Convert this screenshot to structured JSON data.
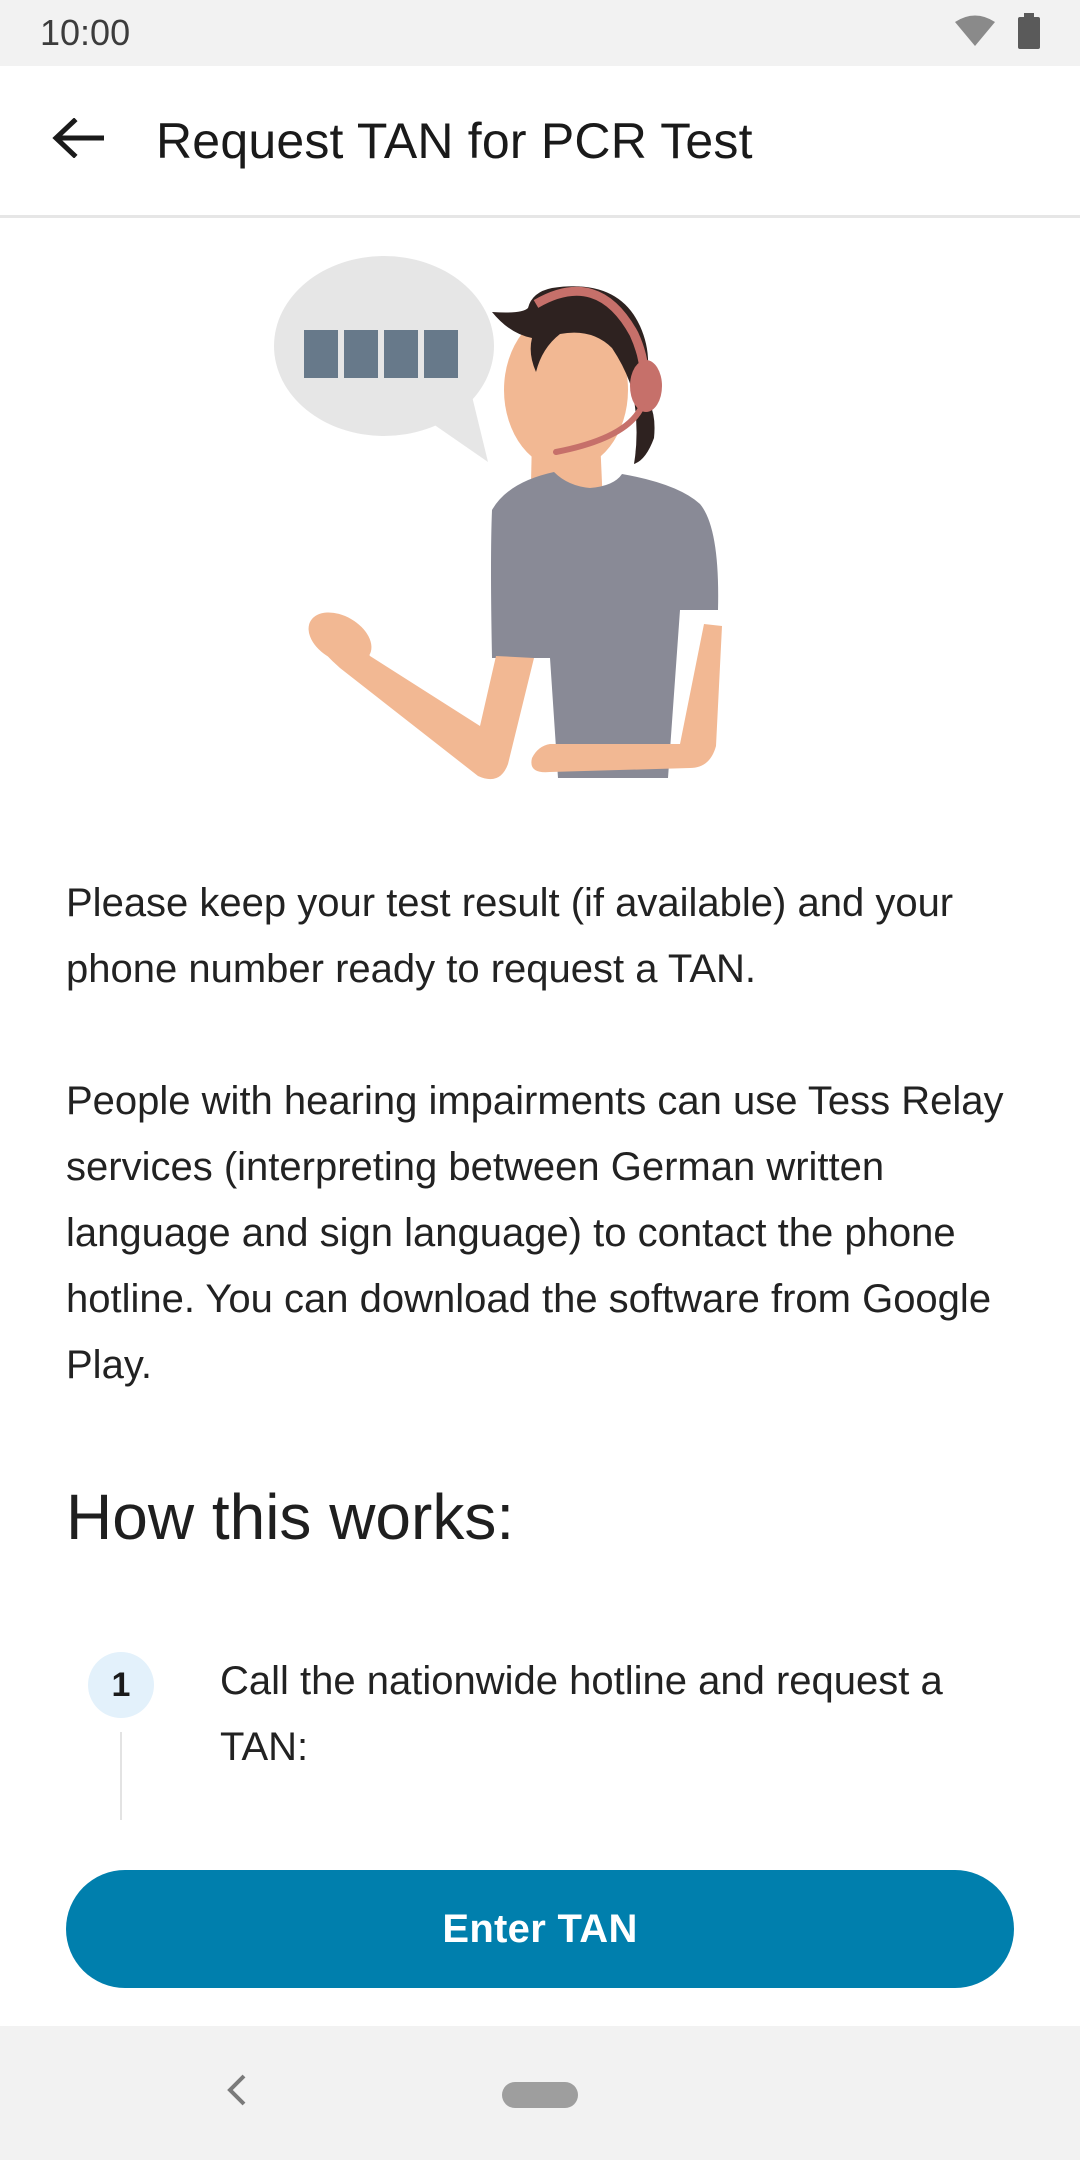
{
  "status_bar": {
    "time": "10:00"
  },
  "app_bar": {
    "title": "Request TAN for PCR Test",
    "back_icon": "arrow-left-icon"
  },
  "illustration": {
    "bubble_label": "hotline-agent-illustration"
  },
  "content": {
    "paragraph_1": "Please keep your test result (if available) and your phone number ready to request a TAN.",
    "paragraph_2": "People with hearing impairments can use Tess Relay services (interpreting between German written language and sign language) to contact the phone hotline. You can download the software from Google Play.",
    "section_title": "How this works:",
    "steps": [
      {
        "number": "1",
        "text": "Call the nationwide hotline and request a TAN:"
      }
    ]
  },
  "footer": {
    "button_label": "Enter TAN"
  },
  "colors": {
    "primary": "#007fad",
    "step_badge": "#e3f1fb",
    "bars": "#f2f2f2"
  }
}
